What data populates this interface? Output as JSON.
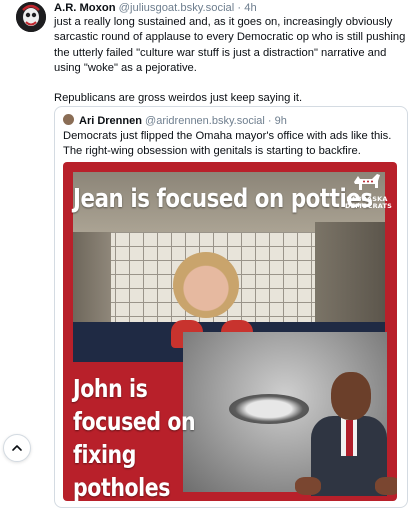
{
  "post": {
    "author_name": "A.R. Moxon",
    "author_handle": "@juliusgoat.bsky.social",
    "separator": "·",
    "time": "4h",
    "paragraphs": [
      "just a really long sustained and, as it goes on, increasingly obviously sarcastic round of applause to every Democratic op who is still pushing the utterly failed \"culture war stuff is just a distraction\" narrative and using \"woke\" as a pejorative.",
      "Republicans are gross weirdos just keep saying it."
    ]
  },
  "quote": {
    "author_name": "Ari Drennen",
    "author_handle": "@aridrennen.bsky.social",
    "separator": "·",
    "time": "9h",
    "text": "Democrats just flipped the Omaha mayor's office with ads like this. The right-wing obsession with genitals is starting to backfire."
  },
  "ad": {
    "headline_top": "Jean is focused on potties",
    "headline_bottom": "John is focused on fixing potholes",
    "logo_line1": "NEBRASKA",
    "logo_line2": "DEMOCRATS"
  },
  "colors": {
    "ad_red": "#b8202a",
    "link_gray": "#6f7f8f"
  },
  "icons": {
    "scroll_top": "chevron-up-icon",
    "logo": "donkey-icon"
  }
}
